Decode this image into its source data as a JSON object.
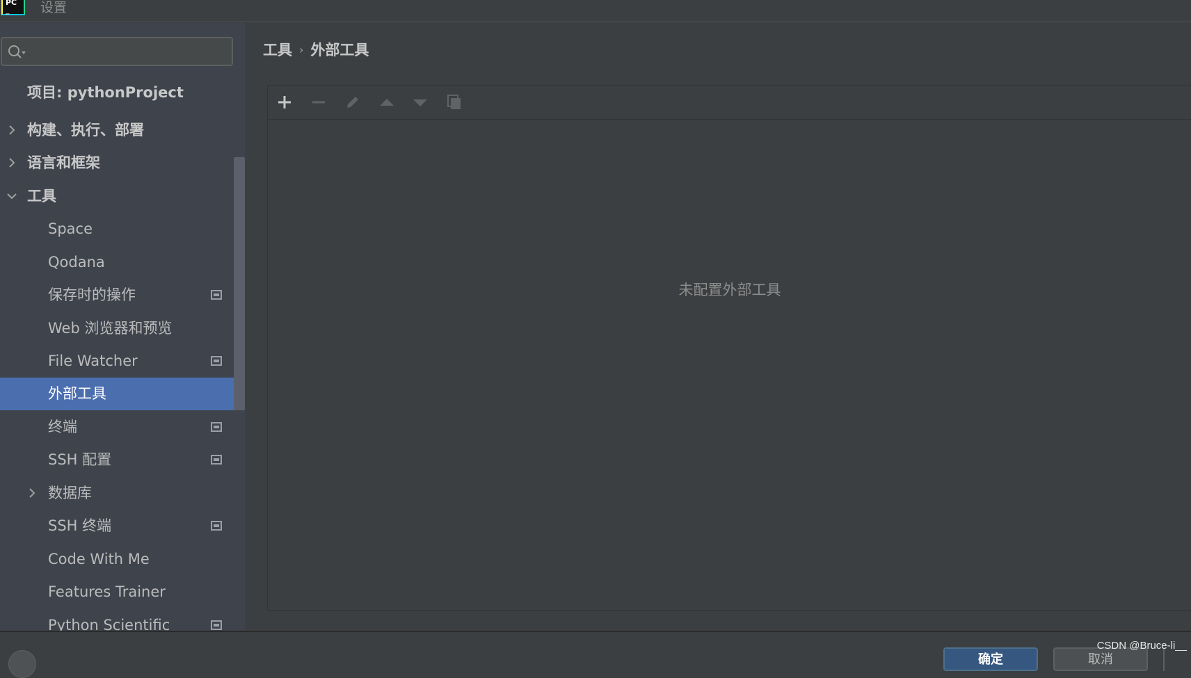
{
  "window": {
    "title": "设置"
  },
  "search": {
    "value": "",
    "placeholder": ""
  },
  "sidebar": {
    "items": [
      {
        "label": "项目: pythonProject"
      },
      {
        "label": "构建、执行、部署"
      },
      {
        "label": "语言和框架"
      },
      {
        "label": "工具"
      },
      {
        "label": "Space"
      },
      {
        "label": "Qodana"
      },
      {
        "label": "保存时的操作"
      },
      {
        "label": "Web 浏览器和预览"
      },
      {
        "label": "File Watcher"
      },
      {
        "label": "外部工具"
      },
      {
        "label": "终端"
      },
      {
        "label": "SSH 配置"
      },
      {
        "label": "数据库"
      },
      {
        "label": "SSH 终端"
      },
      {
        "label": "Code With Me"
      },
      {
        "label": "Features Trainer"
      },
      {
        "label": "Python Scientific"
      }
    ],
    "selected": "外部工具"
  },
  "breadcrumb": {
    "parent": "工具",
    "separator": "›",
    "current": "外部工具"
  },
  "toolbar": {
    "icons": [
      "add-icon",
      "remove-icon",
      "edit-icon",
      "move-up-icon",
      "move-down-icon",
      "copy-icon"
    ]
  },
  "content": {
    "empty_text": "未配置外部工具"
  },
  "footer": {
    "ok_label": "确定",
    "cancel_label": "取消"
  },
  "watermark": "CSDN @Bruce-li__",
  "colors": {
    "selected": "#4b6eaf",
    "sidebar_bg": "#3e434c",
    "main_bg": "#3c3f41"
  }
}
